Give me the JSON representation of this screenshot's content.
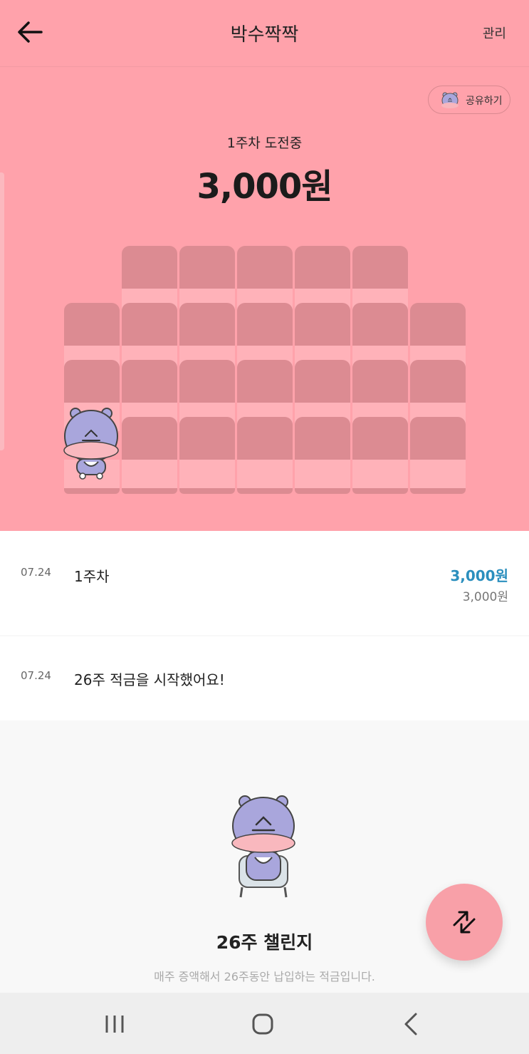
{
  "header": {
    "title": "박수짝짝",
    "manage_label": "관리"
  },
  "hero": {
    "share_label": "공유하기",
    "week_label": "1주차 도전중",
    "amount": "3,000원",
    "seats_filled": 1,
    "seats_total": 26
  },
  "history": [
    {
      "date": "07.24",
      "description": "1주차",
      "amount": "3,000원",
      "total": "3,000원"
    },
    {
      "date": "07.24",
      "description": "26주 적금을 시작했어요!"
    }
  ],
  "challenge": {
    "title": "26주 챌린지",
    "description": "매주 증액해서 26주동안 납입하는 적금입니다."
  },
  "icons": {
    "back": "arrow-left-icon",
    "share_character": "hippo-icon",
    "fab": "swap-arrows-icon",
    "nav_recent": "recent-apps-icon",
    "nav_home": "home-icon",
    "nav_back": "chevron-left-icon"
  },
  "colors": {
    "primary_pink": "#ffa2ab",
    "seat_dark": "#dc8b92",
    "seat_light": "#ffb2b9",
    "accent_blue": "#2b8fbe",
    "hippo_purple": "#a9a6dc"
  }
}
